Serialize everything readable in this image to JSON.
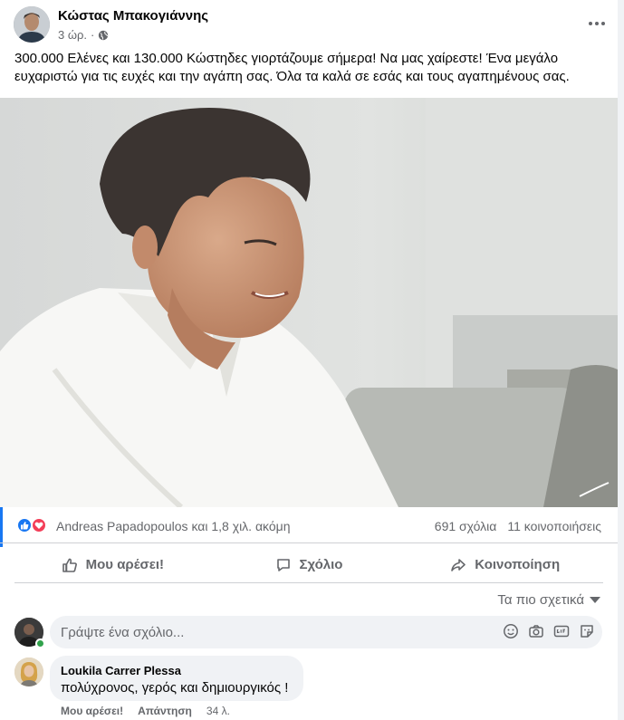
{
  "post": {
    "author": "Κώστας Μπακογιάννης",
    "time": "3 ώρ.",
    "separator": "·",
    "text": "300.000 Ελένες και 130.000 Κώστηδες γιορτάζουμε σήμερα! Να μας χαίρεστε! Ένα μεγάλο ευχαριστώ για τις ευχές και την αγάπη σας. Όλα τα καλά σε εσάς και τους αγαπημένους σας."
  },
  "icons": {
    "globe": "globe-icon",
    "more": "more-options-icon",
    "like_reaction": "like-reaction-icon",
    "love_reaction": "love-reaction-icon",
    "like": "thumbs-up-icon",
    "comment": "comment-icon",
    "share": "share-icon",
    "emoji": "emoji-icon",
    "camera": "camera-icon",
    "gif": "gif-icon",
    "sticker": "sticker-icon"
  },
  "reactions": {
    "summary": "Andreas Papadopoulos και 1,8 χιλ. ακόμη",
    "comments": "691 σχόλια",
    "shares": "11 κοινοποιήσεις"
  },
  "actions": {
    "like": "Μου αρέσει!",
    "comment": "Σχόλιο",
    "share": "Κοινοποίηση"
  },
  "sort": {
    "label": "Τα πιο σχετικά"
  },
  "composer": {
    "placeholder": "Γράψτε ένα σχόλιο..."
  },
  "comment": {
    "author": "Loukila Carrer Plessa",
    "text": "πολύχρονος, γερός και δημιουργικός !",
    "like": "Μου αρέσει!",
    "reply": "Απάντηση",
    "time": "34 λ."
  },
  "colors": {
    "accent": "#1877f2",
    "love": "#f33e58",
    "secondary_text": "#65676b",
    "online": "#31a24c"
  }
}
